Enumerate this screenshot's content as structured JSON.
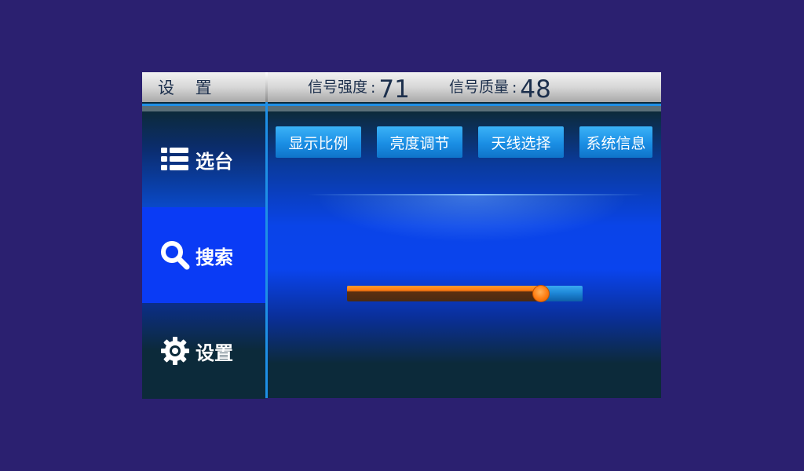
{
  "header": {
    "title": "设 置",
    "signal_strength": {
      "label": "信号强度",
      "colon": ":",
      "value": "71"
    },
    "signal_quality": {
      "label": "信号质量",
      "colon": ":",
      "value": "48"
    }
  },
  "sidebar": {
    "items": [
      {
        "label": "选台",
        "icon": "list-icon"
      },
      {
        "label": "搜索",
        "icon": "search-icon"
      },
      {
        "label": "设置",
        "icon": "gear-icon"
      }
    ],
    "selected_index": 1
  },
  "tabs": [
    {
      "label": "显示比例"
    },
    {
      "label": "亮度调节"
    },
    {
      "label": "天线选择"
    },
    {
      "label": "系统信息"
    }
  ],
  "slider": {
    "value": 0.82
  },
  "colors": {
    "background": "#2b2070",
    "accent_blue": "#1e8fe6",
    "selected_item": "#0a3bf5",
    "slider_orange": "#ff7a10"
  }
}
